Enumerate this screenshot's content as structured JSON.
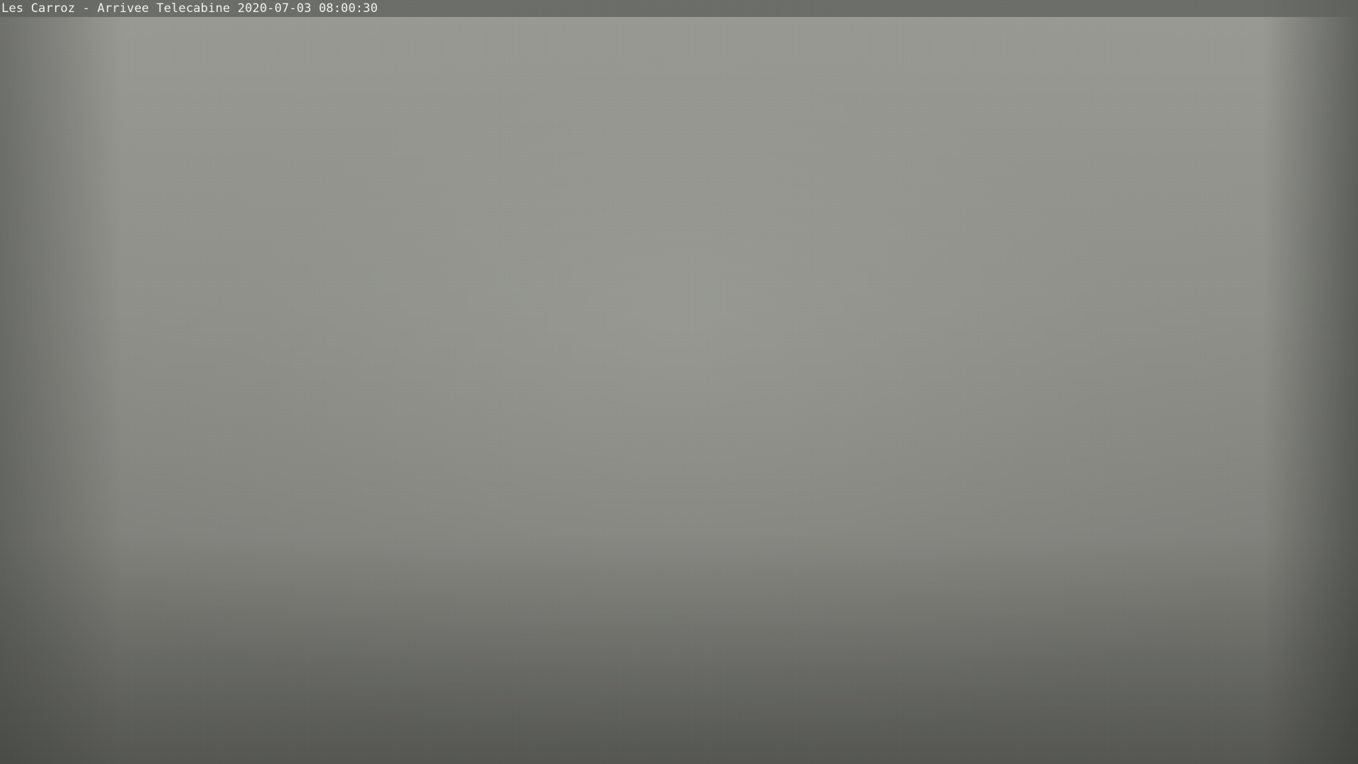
{
  "overlay": {
    "caption": "Les Carroz - Arrivee Telecabine 2020-07-03 08:00:30"
  },
  "colors": {
    "sky": "#9a9b95",
    "bottom": "#6e6f6a",
    "caption_text": "#f2f2f0"
  }
}
